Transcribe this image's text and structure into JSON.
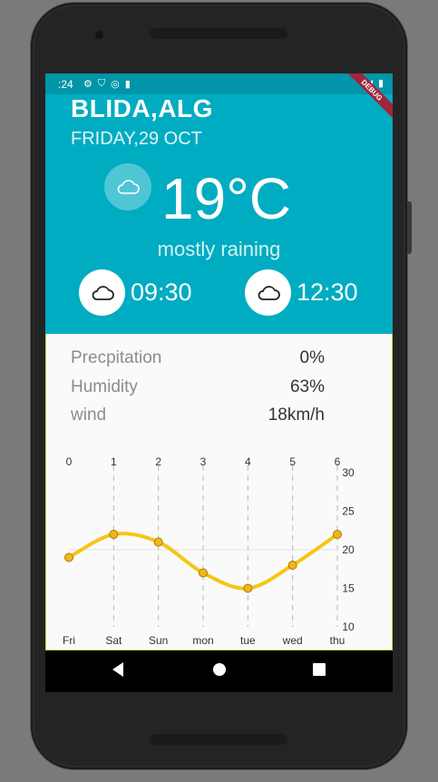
{
  "status_bar": {
    "time": ":24"
  },
  "debug_label": "DEBUG",
  "location": {
    "city": "BLIDA,ALG",
    "date": "FRIDAY,29 OCT"
  },
  "current": {
    "temperature": "19°C",
    "condition": "mostly raining",
    "icon": "cloud-icon"
  },
  "times": [
    {
      "icon": "cloud-icon",
      "time": "09:30"
    },
    {
      "icon": "cloud-icon",
      "time": "12:30"
    }
  ],
  "details": [
    {
      "label": "Precpitation",
      "value": "0%"
    },
    {
      "label": "Humidity",
      "value": "63%"
    },
    {
      "label": "wind",
      "value": "18km/h"
    }
  ],
  "colors": {
    "accent": "#00acc1",
    "line": "#f5c518",
    "nav": "#000000"
  },
  "chart_data": {
    "type": "line",
    "categories": [
      "Fri",
      "Sat",
      "Sun",
      "mon",
      "tue",
      "wed",
      "thu"
    ],
    "top_ticks": [
      "0",
      "1",
      "2",
      "3",
      "4",
      "5",
      "6"
    ],
    "values": [
      19,
      22,
      21,
      17,
      15,
      18,
      22
    ],
    "ylim": [
      10,
      30
    ],
    "yticks": [
      "10",
      "15",
      "20",
      "25",
      "30"
    ],
    "grid": "vertical dashed",
    "y_axis_side": "right"
  }
}
